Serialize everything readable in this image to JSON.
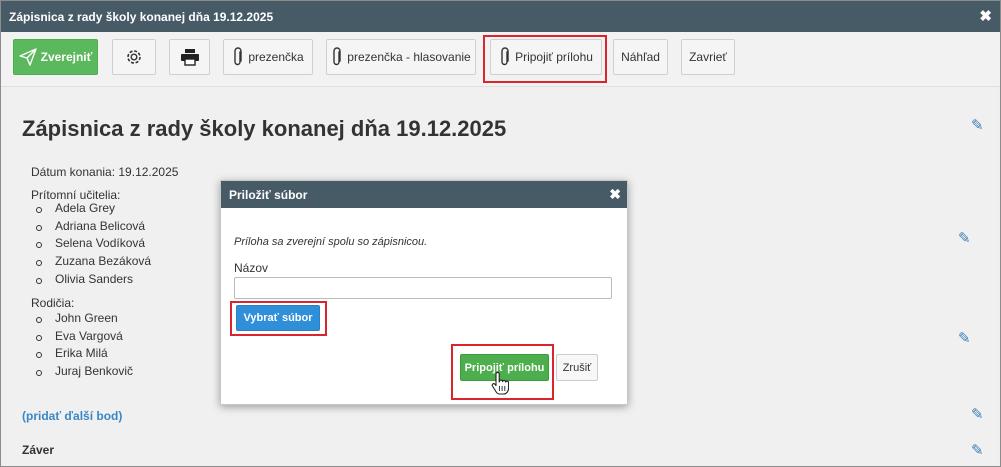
{
  "window": {
    "title": "Zápisnica z rady školy konanej dňa 19.12.2025",
    "close_icon": "close-icon"
  },
  "toolbar": {
    "publish_label": "Zverejniť",
    "settings_icon": "gear-icon",
    "print_icon": "printer-icon",
    "attendance_label": "prezenčka",
    "attendance_voting_label": "prezenčka - hlasovanie",
    "attach_label": "Pripojiť prílohu",
    "preview_label": "Náhľad",
    "close_label": "Zavrieť"
  },
  "document": {
    "title": "Zápisnica z rady školy konanej dňa 19.12.2025",
    "date_line": "Dátum konania: 19.12.2025",
    "teachers_heading": "Prítomní učitelia:",
    "teachers": [
      "Adela Grey",
      "Adriana Belicová",
      "Selena Vodíková",
      "Zuzana Bezáková",
      "Olivia Sanders"
    ],
    "parents_heading": "Rodičia:",
    "parents": [
      "John Green",
      "Eva Vargová",
      "Erika Milá",
      "Juraj Benkovič"
    ],
    "add_point_link": "(pridať ďalší bod)",
    "conclusion_heading": "Záver",
    "edit_icon": "pencil-icon"
  },
  "dialog": {
    "title": "Priložiť súbor",
    "info": "Príloha sa zverejní spolu so zápisnicou.",
    "name_label": "Názov",
    "name_value": "",
    "choose_file_label": "Vybrať súbor",
    "attach_label": "Pripojiť prílohu",
    "cancel_label": "Zrušiť"
  },
  "colors": {
    "header_bg": "#475b66",
    "highlight": "#d9252b",
    "green": "#5cb85c",
    "blue": "#2f8fd9",
    "link": "#3b87c4"
  }
}
